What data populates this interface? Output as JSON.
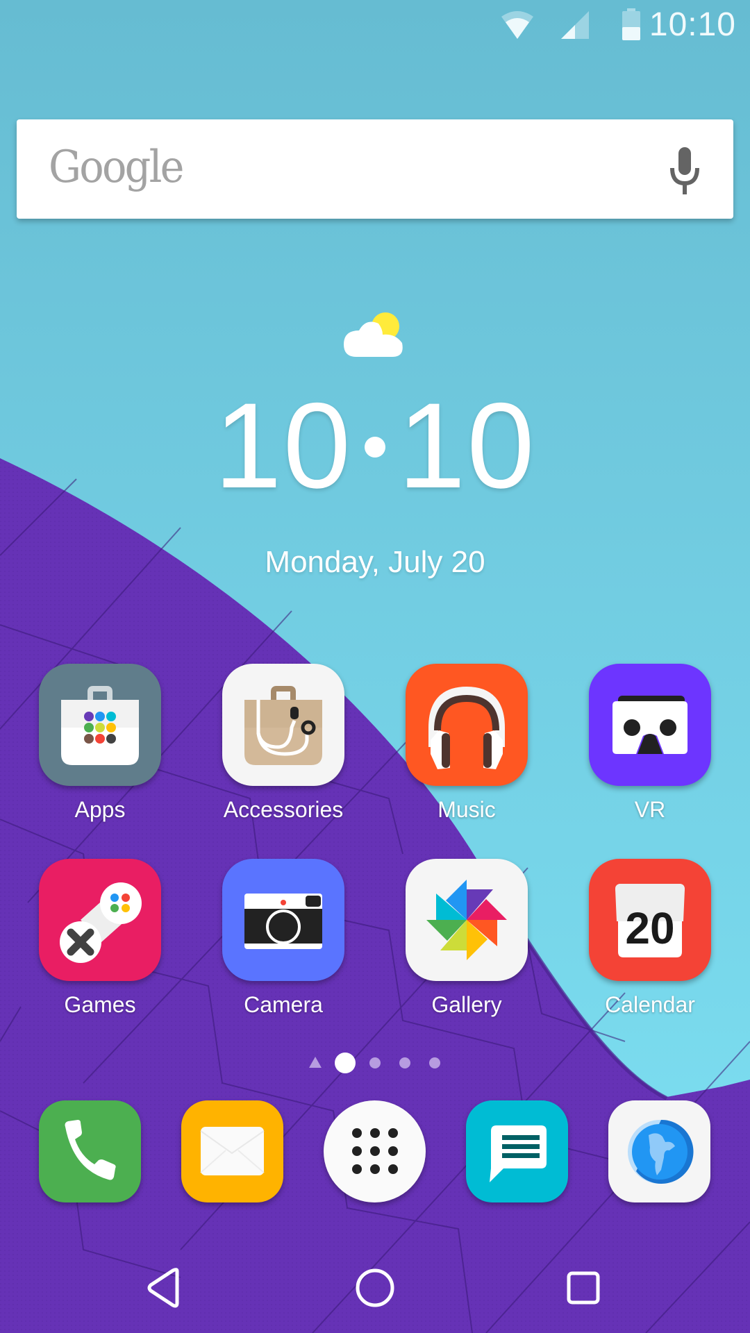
{
  "status_bar": {
    "time": "10:10",
    "icons": [
      "wifi-icon",
      "cellular-signal-icon",
      "battery-icon"
    ]
  },
  "search": {
    "logo_text": "Google",
    "mic_icon": "mic-icon"
  },
  "clock_widget": {
    "weather_icon": "partly-cloudy-icon",
    "hours": "10",
    "minutes": "10",
    "date": "Monday, July 20"
  },
  "apps": [
    {
      "label": "Apps",
      "icon": "shopping-bag-apps-icon",
      "color": "#607d8b"
    },
    {
      "label": "Accessories",
      "icon": "shopping-bag-earphones-icon",
      "color": "#f5f5f5"
    },
    {
      "label": "Music",
      "icon": "headphones-icon",
      "color": "#ff5722"
    },
    {
      "label": "VR",
      "icon": "vr-headset-icon",
      "color": "#6d35ff"
    },
    {
      "label": "Games",
      "icon": "gamepad-icon",
      "color": "#e91e63"
    },
    {
      "label": "Camera",
      "icon": "camera-icon",
      "color": "#5a74ff"
    },
    {
      "label": "Gallery",
      "icon": "pinwheel-icon",
      "color": "#f5f5f5"
    },
    {
      "label": "Calendar",
      "icon": "calendar-icon",
      "color": "#f44336",
      "day": "20"
    }
  ],
  "page_indicator": {
    "pages": 4,
    "current": 1,
    "home_marker": "triangle-icon"
  },
  "dock": [
    {
      "name": "Phone",
      "icon": "phone-icon",
      "color": "#4caf50"
    },
    {
      "name": "Email",
      "icon": "envelope-icon",
      "color": "#ffb300"
    },
    {
      "name": "All apps",
      "icon": "app-drawer-icon",
      "color": "#fafafa"
    },
    {
      "name": "Messages",
      "icon": "message-icon",
      "color": "#00bcd4"
    },
    {
      "name": "Browser",
      "icon": "globe-icon",
      "color": "#f5f5f5"
    }
  ],
  "nav": {
    "back": "back-icon",
    "home": "home-icon",
    "recents": "recents-icon"
  },
  "colors": {
    "sky": "#6ec9df",
    "wallpaper_purple": "#6632b6"
  }
}
